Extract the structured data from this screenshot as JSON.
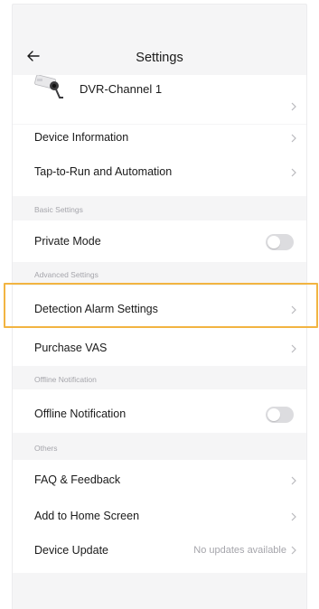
{
  "header": {
    "title": "Settings",
    "back_icon": "arrow-left-icon"
  },
  "device": {
    "name": "DVR-Channel 1",
    "icon": "security-camera-icon"
  },
  "items": {
    "device_information": "Device Information",
    "tap_to_run": "Tap-to-Run and Automation",
    "private_mode": "Private Mode",
    "detection_alarm": "Detection Alarm Settings",
    "purchase_vas": "Purchase VAS",
    "offline_notification": "Offline Notification",
    "faq_feedback": "FAQ & Feedback",
    "add_home": "Add to Home Screen",
    "device_update": "Device Update",
    "device_update_status": "No updates available"
  },
  "sections": {
    "basic": "Basic Settings",
    "advanced": "Advanced Settings",
    "offline": "Offline Notification",
    "others": "Others"
  },
  "toggles": {
    "private_mode_on": false,
    "offline_notification_on": false
  },
  "colors": {
    "highlight": "#f2b441",
    "toggle_off": "#dcdcdf",
    "section_text": "#a5a5ab"
  }
}
